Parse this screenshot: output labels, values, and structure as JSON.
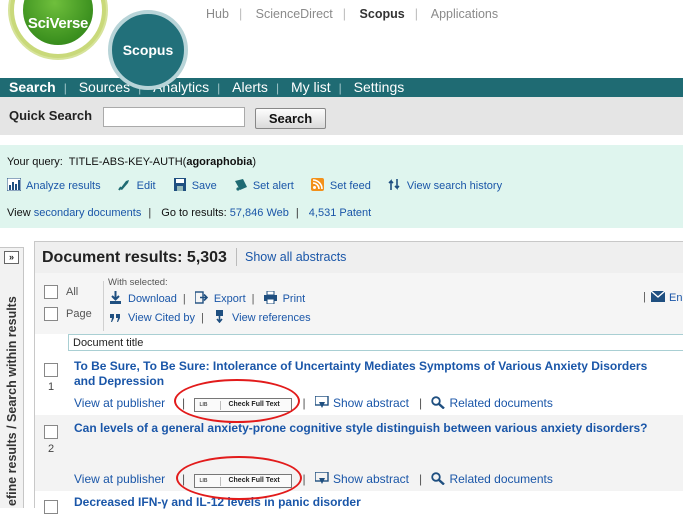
{
  "header": {
    "sciverse_logo": "SciVerse",
    "scopus_logo": "Scopus",
    "top_links": [
      "Hub",
      "ScienceDirect",
      "Scopus",
      "Applications"
    ],
    "active_top_link": "Scopus"
  },
  "nav": {
    "items": [
      "Search",
      "Sources",
      "Analytics",
      "Alerts",
      "My list",
      "Settings"
    ],
    "active": "Search"
  },
  "quick_search": {
    "label": "Quick Search",
    "input_value": "",
    "button_label": "Search"
  },
  "query": {
    "label": "Your query:",
    "prefix": "TITLE-ABS-KEY-AUTH(",
    "term": "agoraphobia",
    "suffix": ")",
    "tools": [
      "Analyze results",
      "Edit",
      "Save",
      "Set alert",
      "Set feed",
      "View search history"
    ],
    "view_label": "View",
    "secondary_link": "secondary documents",
    "goto_label": "Go to results:",
    "web_results": "57,846 Web",
    "patent_results": "4,531 Patent"
  },
  "side_tab": {
    "toggle": "»",
    "text": "efine results / Search within results"
  },
  "results": {
    "title": "Document results: 5,303",
    "show_all": "Show all abstracts",
    "select_all": "All",
    "select_page": "Page",
    "with_selected": "With selected:",
    "actions_row1": [
      "Download",
      "Export",
      "Print"
    ],
    "actions_row2": [
      "View Cited by",
      "View references"
    ],
    "email_label": "En",
    "column_title": "Document title",
    "view_publisher": "View at publisher",
    "check_full_text": "Check Full Text",
    "show_abstract": "Show abstract",
    "related_documents": "Related documents",
    "items": [
      {
        "num": "1",
        "title": "To Be Sure, To Be Sure: Intolerance of Uncertainty Mediates Symptoms of Various Anxiety Disorders and Depression"
      },
      {
        "num": "2",
        "title": "Can levels of a general anxiety-prone cognitive style distinguish between various anxiety disorders?"
      },
      {
        "num": "",
        "title": "Decreased IFN-γ and IL-12 levels in panic disorder"
      }
    ]
  },
  "colors": {
    "nav_bg": "#1f6b73",
    "link": "#1a56a8",
    "query_bg": "#dff5ee",
    "annotation_circle": "#e21b1b"
  }
}
